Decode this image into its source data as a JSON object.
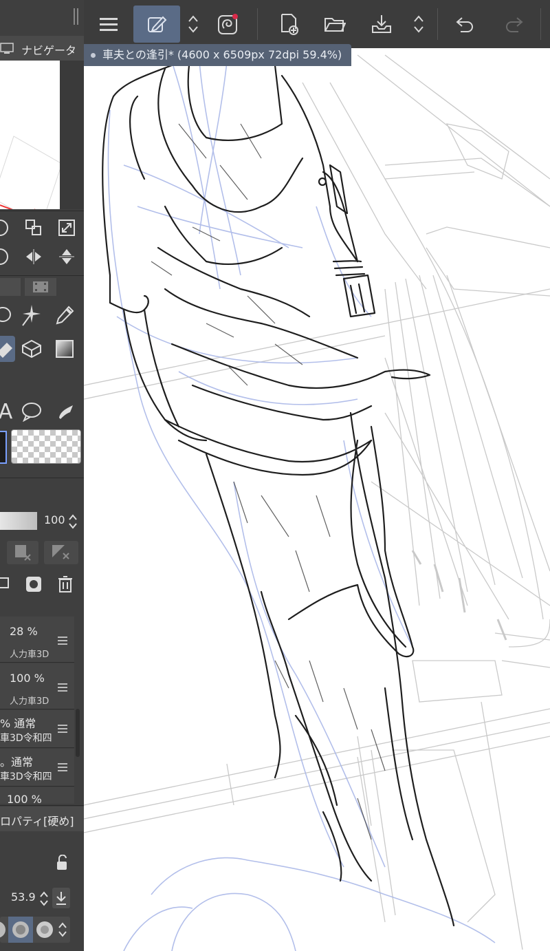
{
  "toolbar": {
    "menu_icon": "hamburger-icon",
    "active_tool_icon": "pen-tool-icon",
    "redo_disabled": true
  },
  "document": {
    "tab_title": "車夫との逢引* (4600 x 6509px 72dpi 59.4%)"
  },
  "navigator": {
    "title": "ナビゲータ"
  },
  "brush": {
    "opacity_value": "100"
  },
  "layers": [
    {
      "opacity": "28 %",
      "name": "人力車3D"
    },
    {
      "opacity": "100 %",
      "name": "人力車3D"
    },
    {
      "opacity": "% 通常",
      "name": "車3D令和四"
    },
    {
      "opacity": "。通常",
      "name": "車3D令和四"
    },
    {
      "opacity": "100 %",
      "name": ""
    }
  ],
  "tool_property": {
    "title": "ロパティ[硬め]",
    "size_value": "53.9"
  },
  "colors": {
    "panel_bg": "#3f3f3f",
    "toolbar_bg": "#3c3c3c",
    "active_button": "#5a6b86",
    "tab_bg": "#566275",
    "sketch_line": "#aab8e8",
    "ink_line": "#1e1e1e",
    "guide_line": "#c9c9c9"
  }
}
